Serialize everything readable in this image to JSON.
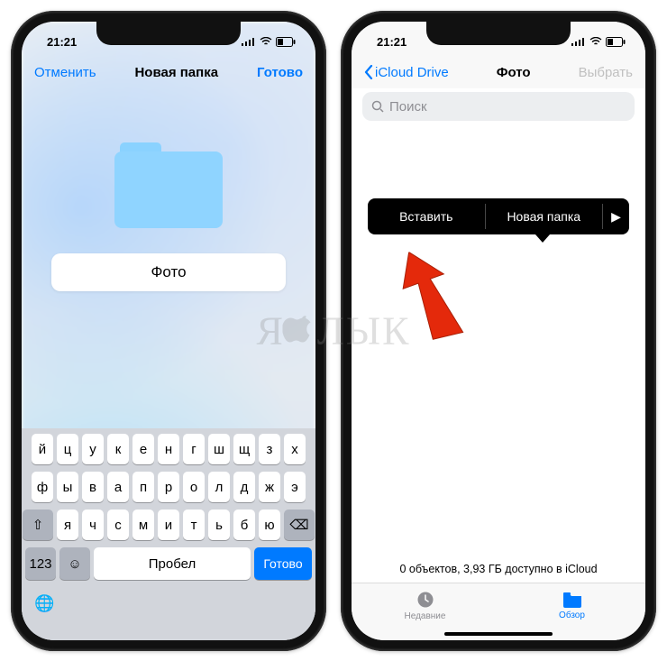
{
  "status": {
    "time": "21:21"
  },
  "phone1": {
    "nav": {
      "cancel": "Отменить",
      "title": "Новая папка",
      "done": "Готово"
    },
    "folder_name": "Фото",
    "keyboard": {
      "row1": [
        "й",
        "ц",
        "у",
        "к",
        "е",
        "н",
        "г",
        "ш",
        "щ",
        "з",
        "х"
      ],
      "row2": [
        "ф",
        "ы",
        "в",
        "а",
        "п",
        "р",
        "о",
        "л",
        "д",
        "ж",
        "э"
      ],
      "row3": [
        "я",
        "ч",
        "с",
        "м",
        "и",
        "т",
        "ь",
        "б",
        "ю"
      ],
      "shift": "⇧",
      "backspace": "⌫",
      "numbers": "123",
      "emoji": "☺",
      "space": "Пробел",
      "return": "Готово",
      "globe": "🌐"
    }
  },
  "phone2": {
    "nav": {
      "back": "iCloud Drive",
      "title": "Фото",
      "select": "Выбрать"
    },
    "search_placeholder": "Поиск",
    "ctx": {
      "paste": "Вставить",
      "new_folder": "Новая папка",
      "more": "▶"
    },
    "status_text": "0 объектов, 3,93 ГБ доступно в iCloud",
    "tabs": {
      "recent": "Недавние",
      "browse": "Обзор"
    }
  },
  "watermark": "ЯБЛЫК"
}
